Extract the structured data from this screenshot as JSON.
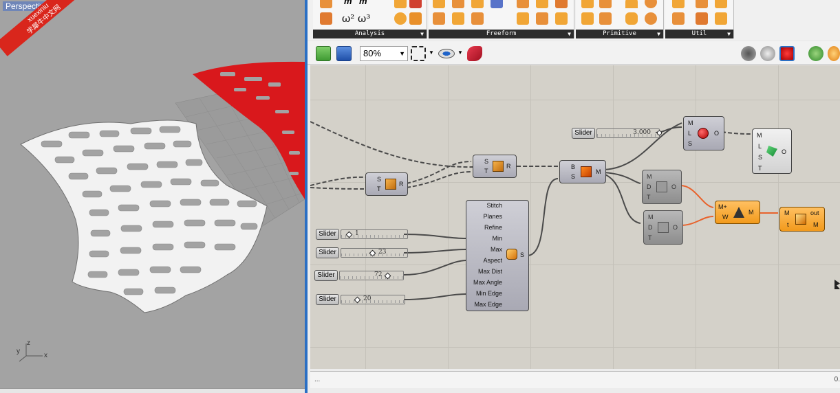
{
  "viewport": {
    "title": "Perspective",
    "watermark_line1": "xuexiniu",
    "watermark_line2": "学犀牛中文网",
    "axis_z": "z",
    "axis_y": "y",
    "axis_x": "x",
    "surface_color": "#d9181c"
  },
  "ribbon": {
    "groups": [
      {
        "label": "Analysis"
      },
      {
        "label": "Freeform"
      },
      {
        "label": "Primitive"
      },
      {
        "label": "Util"
      }
    ],
    "analysis_text1": "m⁻ m",
    "analysis_text2": "ω² ω³"
  },
  "toolbar": {
    "zoom_value": "80%"
  },
  "canvas": {
    "sliders": [
      {
        "label": "Slider",
        "value": "3.000"
      },
      {
        "label": "Slider",
        "value": "1"
      },
      {
        "label": "Slider",
        "value": "23"
      },
      {
        "label": "Slider",
        "value": "72"
      },
      {
        "label": "Slider",
        "value": "20"
      }
    ],
    "comp_ST1": {
      "in": [
        "S",
        "T"
      ],
      "out": "R"
    },
    "comp_ST2": {
      "in": [
        "S",
        "T"
      ],
      "out": "R"
    },
    "comp_BS": {
      "in": [
        "B",
        "S"
      ],
      "out": "M"
    },
    "comp_MLS": {
      "in": [
        "M",
        "L",
        "S"
      ],
      "out": "O"
    },
    "comp_MLST": {
      "in": [
        "M",
        "L",
        "S",
        "T"
      ],
      "out": "O"
    },
    "comp_MDT1": {
      "in": [
        "M",
        "D",
        "T"
      ],
      "out": "O"
    },
    "comp_MDT2": {
      "in": [
        "M",
        "D",
        "T"
      ],
      "out": "O"
    },
    "comp_MW": {
      "in": [
        "M+",
        "W"
      ],
      "out": "M"
    },
    "comp_out": {
      "in": [
        "M",
        "t"
      ],
      "out": [
        "out",
        "M"
      ]
    },
    "comp_mesh": {
      "inputs": [
        "Stitch",
        "Planes",
        "Refine",
        "Min",
        "Max",
        "Aspect",
        "Max Dist",
        "Max Angle",
        "Min Edge",
        "Max Edge"
      ],
      "out": "S"
    }
  },
  "status": {
    "left": "...",
    "right": "0."
  }
}
